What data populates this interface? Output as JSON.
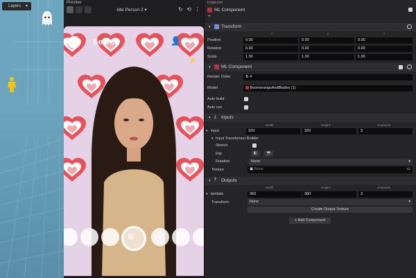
{
  "scene": {
    "layers_label": "Layers"
  },
  "preview": {
    "panel_title": "Preview",
    "title": "Idle Person 2",
    "search_label": "Search"
  },
  "inspector": {
    "panel_title": "Inspector",
    "object_name": "ML Component",
    "add_symbol": "+",
    "transform": {
      "title": "Transform",
      "col_x": "x",
      "col_y": "y",
      "col_z": "z",
      "rows": [
        {
          "label": "Position",
          "values": [
            "0.00",
            "0.00",
            "0.00"
          ]
        },
        {
          "label": "Rotation",
          "values": [
            "0.00",
            "0.00",
            "0.00"
          ]
        },
        {
          "label": "Scale",
          "values": [
            "1.00",
            "1.00",
            "1.00"
          ]
        }
      ]
    },
    "ml": {
      "title": "ML Component",
      "render_order_label": "Render Order",
      "render_order_value": "4",
      "model_label": "Model",
      "model_value": "BoomerangsAndBlades (1)",
      "auto_build_label": "Auto build",
      "auto_run_label": "Auto run"
    },
    "inputs": {
      "title": "Inputs",
      "col_width": "Width",
      "col_height": "Height",
      "col_channels": "Channels",
      "input_label": "input",
      "input_values": [
        "320",
        "320",
        "3"
      ],
      "builder_label": "Input Transformer Builder",
      "stretch_label": "Stretch",
      "flip_label": "Flip",
      "rotation_label": "Rotation",
      "rotation_value": "None",
      "texture_label": "Texture",
      "texture_value": "None"
    },
    "outputs": {
      "title": "Outputs",
      "col_width": "Width",
      "col_height": "Height",
      "col_channels": "Channels",
      "lambda_label": "lambda",
      "lambda_values": [
        "360",
        "360",
        "3"
      ],
      "transform_label": "Transform",
      "transform_value": "None",
      "create_button": "Create Output Texture"
    },
    "add_component": "+ Add Component"
  }
}
